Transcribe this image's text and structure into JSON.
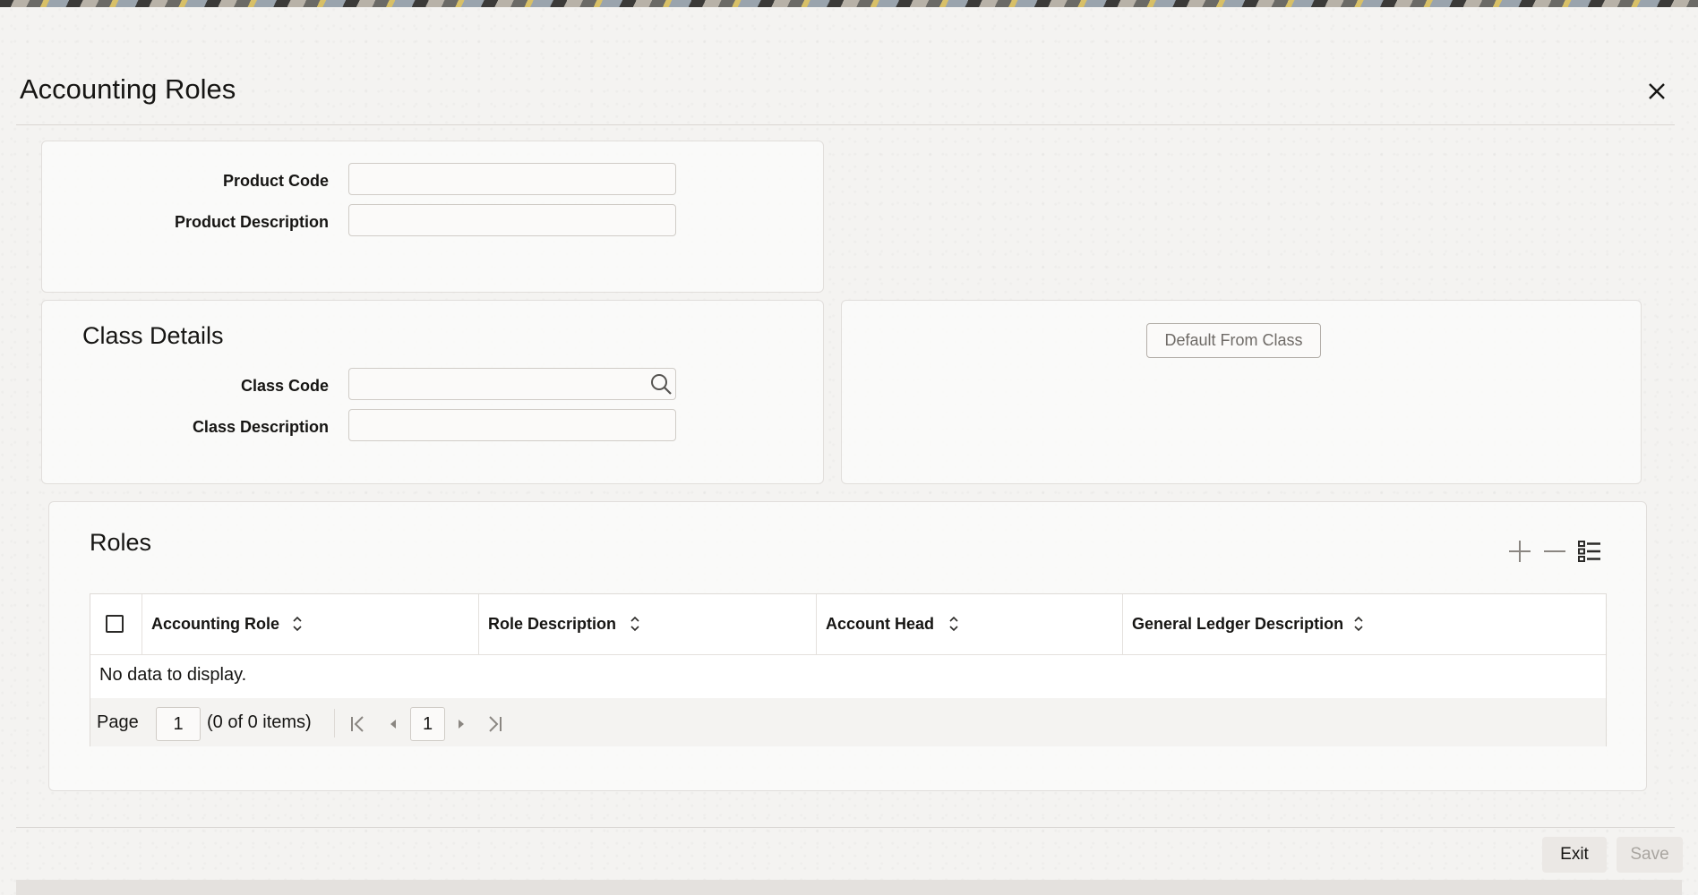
{
  "window": {
    "title": "Accounting Roles",
    "close_icon": "close-icon"
  },
  "product": {
    "code_label": "Product Code",
    "code_value": "",
    "description_label": "Product Description",
    "description_value": ""
  },
  "class_details": {
    "title": "Class Details",
    "code_label": "Class Code",
    "code_value": "",
    "description_label": "Class Description",
    "description_value": "",
    "default_button": "Default From Class"
  },
  "roles": {
    "title": "Roles",
    "columns": [
      "Accounting Role",
      "Role Description",
      "Account Head",
      "General Ledger Description"
    ],
    "empty_message": "No data to display.",
    "pager": {
      "page_label": "Page",
      "page_value": "1",
      "items_text": "(0 of 0 items)",
      "current_page": "1"
    }
  },
  "footer": {
    "exit_label": "Exit",
    "save_label": "Save"
  },
  "colors": {
    "text": "#161513",
    "border": "#d0ccc7",
    "disabled_text": "#6f6b67",
    "background": "#f4f3f1"
  }
}
